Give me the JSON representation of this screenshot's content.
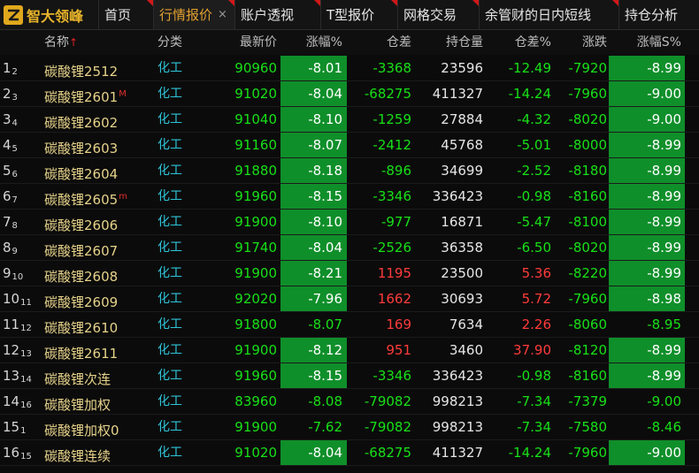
{
  "app": {
    "title": "智大领峰"
  },
  "tabs": [
    {
      "label": "首页"
    },
    {
      "label": "行情报价",
      "active": true
    },
    {
      "label": "账户透视"
    },
    {
      "label": "T型报价"
    },
    {
      "label": "网格交易"
    },
    {
      "label": "余管财的日内短线"
    },
    {
      "label": "持仓分析"
    }
  ],
  "tab_close_glyph": "×",
  "colors": {
    "up": "#ff3b3b",
    "down": "#18e018",
    "down_bg": "#0f8f2a",
    "accent": "#e0a030"
  },
  "columns": {
    "name": "名称",
    "sort_arrow": "↑",
    "category": "分类",
    "latest": "最新价",
    "change_pct": "涨幅%",
    "oi_diff": "仓差",
    "open_interest": "持仓量",
    "oi_diff_pct": "仓差%",
    "change": "涨跌",
    "change_s_pct": "涨幅S%"
  },
  "rows": [
    {
      "idx": "1",
      "sub": "2",
      "name": "碳酸锂2512",
      "mark": "",
      "cat": "化工",
      "price": "90960",
      "chg": "-8.01",
      "chg_bg": true,
      "cangc": "-3368",
      "oi": "23596",
      "cangp": "-12.49",
      "zd": "-7920",
      "chgs": "-8.99",
      "chgs_bg": true
    },
    {
      "idx": "2",
      "sub": "3",
      "name": "碳酸锂2601",
      "mark": "M",
      "cat": "化工",
      "price": "91020",
      "chg": "-8.04",
      "chg_bg": true,
      "cangc": "-68275",
      "oi": "411327",
      "cangp": "-14.24",
      "zd": "-7960",
      "chgs": "-9.00",
      "chgs_bg": true
    },
    {
      "idx": "3",
      "sub": "4",
      "name": "碳酸锂2602",
      "mark": "",
      "cat": "化工",
      "price": "91040",
      "chg": "-8.10",
      "chg_bg": true,
      "cangc": "-1259",
      "oi": "27884",
      "cangp": "-4.32",
      "zd": "-8020",
      "chgs": "-9.00",
      "chgs_bg": true
    },
    {
      "idx": "4",
      "sub": "5",
      "name": "碳酸锂2603",
      "mark": "",
      "cat": "化工",
      "price": "91160",
      "chg": "-8.07",
      "chg_bg": true,
      "cangc": "-2412",
      "oi": "45768",
      "cangp": "-5.01",
      "zd": "-8000",
      "chgs": "-8.99",
      "chgs_bg": true
    },
    {
      "idx": "5",
      "sub": "6",
      "name": "碳酸锂2604",
      "mark": "",
      "cat": "化工",
      "price": "91880",
      "chg": "-8.18",
      "chg_bg": true,
      "cangc": "-896",
      "oi": "34699",
      "cangp": "-2.52",
      "zd": "-8180",
      "chgs": "-8.99",
      "chgs_bg": true
    },
    {
      "idx": "6",
      "sub": "7",
      "name": "碳酸锂2605",
      "mark": "m",
      "cat": "化工",
      "price": "91960",
      "chg": "-8.15",
      "chg_bg": true,
      "cangc": "-3346",
      "oi": "336423",
      "cangp": "-0.98",
      "zd": "-8160",
      "chgs": "-8.99",
      "chgs_bg": true
    },
    {
      "idx": "7",
      "sub": "8",
      "name": "碳酸锂2606",
      "mark": "",
      "cat": "化工",
      "price": "91900",
      "chg": "-8.10",
      "chg_bg": true,
      "cangc": "-977",
      "oi": "16871",
      "cangp": "-5.47",
      "zd": "-8100",
      "chgs": "-8.99",
      "chgs_bg": true
    },
    {
      "idx": "8",
      "sub": "9",
      "name": "碳酸锂2607",
      "mark": "",
      "cat": "化工",
      "price": "91740",
      "chg": "-8.04",
      "chg_bg": true,
      "cangc": "-2526",
      "oi": "36358",
      "cangp": "-6.50",
      "zd": "-8020",
      "chgs": "-8.99",
      "chgs_bg": true
    },
    {
      "idx": "9",
      "sub": "10",
      "name": "碳酸锂2608",
      "mark": "",
      "cat": "化工",
      "price": "91900",
      "chg": "-8.21",
      "chg_bg": true,
      "cangc": "1195",
      "oi": "23500",
      "cangp": "5.36",
      "zd": "-8220",
      "chgs": "-8.99",
      "chgs_bg": true
    },
    {
      "idx": "10",
      "sub": "11",
      "name": "碳酸锂2609",
      "mark": "",
      "cat": "化工",
      "price": "92020",
      "chg": "-7.96",
      "chg_bg": true,
      "cangc": "1662",
      "oi": "30693",
      "cangp": "5.72",
      "zd": "-7960",
      "chgs": "-8.98",
      "chgs_bg": true
    },
    {
      "idx": "11",
      "sub": "12",
      "name": "碳酸锂2610",
      "mark": "",
      "cat": "化工",
      "price": "91800",
      "chg": "-8.07",
      "chg_bg": false,
      "cangc": "169",
      "oi": "7634",
      "cangp": "2.26",
      "zd": "-8060",
      "chgs": "-8.95",
      "chgs_bg": false
    },
    {
      "idx": "12",
      "sub": "13",
      "name": "碳酸锂2611",
      "mark": "",
      "cat": "化工",
      "price": "91900",
      "chg": "-8.12",
      "chg_bg": true,
      "cangc": "951",
      "oi": "3460",
      "cangp": "37.90",
      "zd": "-8120",
      "chgs": "-8.99",
      "chgs_bg": true
    },
    {
      "idx": "13",
      "sub": "14",
      "name": "碳酸锂次连",
      "mark": "",
      "cat": "化工",
      "price": "91960",
      "chg": "-8.15",
      "chg_bg": true,
      "cangc": "-3346",
      "oi": "336423",
      "cangp": "-0.98",
      "zd": "-8160",
      "chgs": "-8.99",
      "chgs_bg": true
    },
    {
      "idx": "14",
      "sub": "16",
      "name": "碳酸锂加权",
      "mark": "",
      "cat": "化工",
      "price": "83960",
      "chg": "-8.08",
      "chg_bg": false,
      "cangc": "-79082",
      "oi": "998213",
      "cangp": "-7.34",
      "zd": "-7379",
      "chgs": "-9.00",
      "chgs_bg": false
    },
    {
      "idx": "15",
      "sub": "1",
      "name": "碳酸锂加权0",
      "mark": "",
      "cat": "化工",
      "price": "91900",
      "chg": "-7.62",
      "chg_bg": false,
      "cangc": "-79082",
      "oi": "998213",
      "cangp": "-7.34",
      "zd": "-7580",
      "chgs": "-8.46",
      "chgs_bg": false
    },
    {
      "idx": "16",
      "sub": "15",
      "name": "碳酸锂连续",
      "mark": "",
      "cat": "化工",
      "price": "91020",
      "chg": "-8.04",
      "chg_bg": true,
      "cangc": "-68275",
      "oi": "411327",
      "cangp": "-14.24",
      "zd": "-7960",
      "chgs": "-9.00",
      "chgs_bg": true
    }
  ]
}
